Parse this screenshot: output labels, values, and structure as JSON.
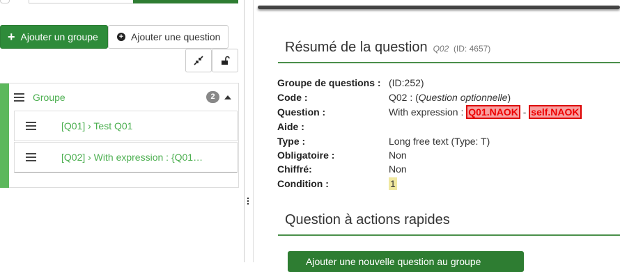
{
  "toolbar": {
    "add_group_label": "Ajouter un groupe",
    "add_question_label": "Ajouter une question"
  },
  "group": {
    "title": "Groupe",
    "count": "2",
    "questions": [
      {
        "label": "[Q01] › Test Q01"
      },
      {
        "label": "[Q02] › With expression : {Q01…"
      }
    ]
  },
  "summary": {
    "title": "Résumé de la question",
    "code_italic": "Q02",
    "id_text": "(ID: 4657)",
    "rows": {
      "group": {
        "key": "Groupe de questions :",
        "value": "(ID:252)"
      },
      "code": {
        "key": "Code :",
        "value_prefix": "Q02 : (",
        "value_italic": "Question optionnelle",
        "value_suffix": ")"
      },
      "question": {
        "key": "Question :",
        "value_prefix": "With expression : ",
        "tag1": "Q01.NAOK",
        "sep": " - ",
        "tag2": "self.NAOK"
      },
      "help": {
        "key": "Aide :"
      },
      "type": {
        "key": "Type :",
        "value": "Long free text (Type: T)"
      },
      "mandatory": {
        "key": "Obligatoire :",
        "value": "Non"
      },
      "encrypted": {
        "key": "Chiffré:",
        "value": "Non"
      },
      "condition": {
        "key": "Condition :",
        "value": "1"
      }
    }
  },
  "quick_actions": {
    "title": "Question à actions rapides",
    "button_label": "Ajouter une nouvelle question au groupe"
  },
  "colors": {
    "accent_green": "#2e8b3a",
    "group_bar": "#5cb85c",
    "expression_red": "#dd0000"
  }
}
